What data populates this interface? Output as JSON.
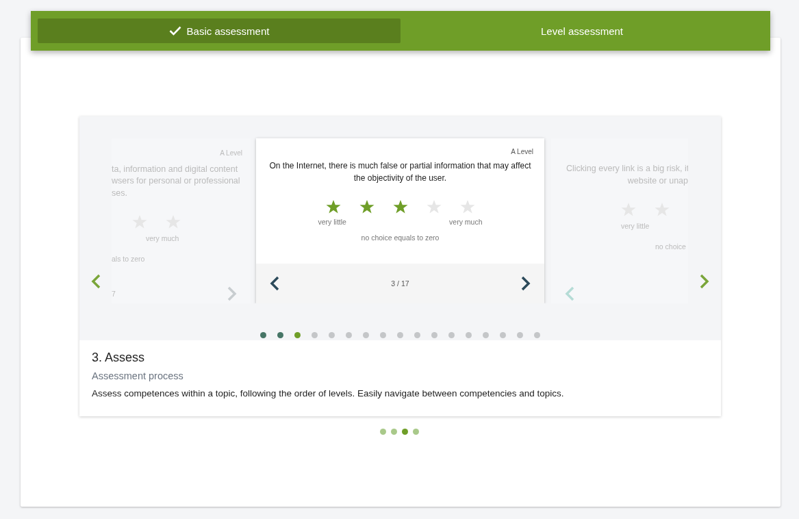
{
  "tabs": [
    {
      "label": "Basic assessment",
      "selected": true,
      "done": true
    },
    {
      "label": "Level assessment",
      "selected": false,
      "done": false
    }
  ],
  "carousel": {
    "previous_card": {
      "level": "A Level",
      "lines": [
        "ta, information and digital content",
        "wsers for personal or professional",
        "ses."
      ],
      "scale_label": "very much",
      "note": "als to zero",
      "counter": "7"
    },
    "current_card": {
      "level": "A Level",
      "question": "On the Internet, there is much false or partial information that may affect the objectivity of the user.",
      "stars": 3,
      "scale_low": "very little",
      "scale_high": "very much",
      "note": "no choice equals to zero",
      "counter": "3 / 17"
    },
    "next_card": {
      "lines": [
        "Clicking every link is a big risk, it",
        "website or unap"
      ],
      "scale_label": "very little",
      "note": "no choice"
    },
    "question_dots": [
      {
        "visited": true,
        "selected": false
      },
      {
        "visited": true,
        "selected": false
      },
      {
        "visited": false,
        "selected": true
      },
      {
        "visited": false,
        "selected": false
      },
      {
        "visited": false,
        "selected": false
      },
      {
        "visited": false,
        "selected": false
      },
      {
        "visited": false,
        "selected": false
      },
      {
        "visited": false,
        "selected": false
      },
      {
        "visited": false,
        "selected": false
      },
      {
        "visited": false,
        "selected": false
      },
      {
        "visited": false,
        "selected": false
      },
      {
        "visited": false,
        "selected": false
      },
      {
        "visited": false,
        "selected": false
      },
      {
        "visited": false,
        "selected": false
      },
      {
        "visited": false,
        "selected": false
      },
      {
        "visited": false,
        "selected": false
      },
      {
        "visited": false,
        "selected": false
      }
    ]
  },
  "step": {
    "title": "3. Assess",
    "subtitle": "Assessment process",
    "description": "Assess competences within a topic, following the order of levels. Easily navigate between competencies and topics."
  },
  "step_dots": [
    {
      "selected": false
    },
    {
      "selected": false
    },
    {
      "selected": true
    },
    {
      "selected": false
    }
  ]
}
